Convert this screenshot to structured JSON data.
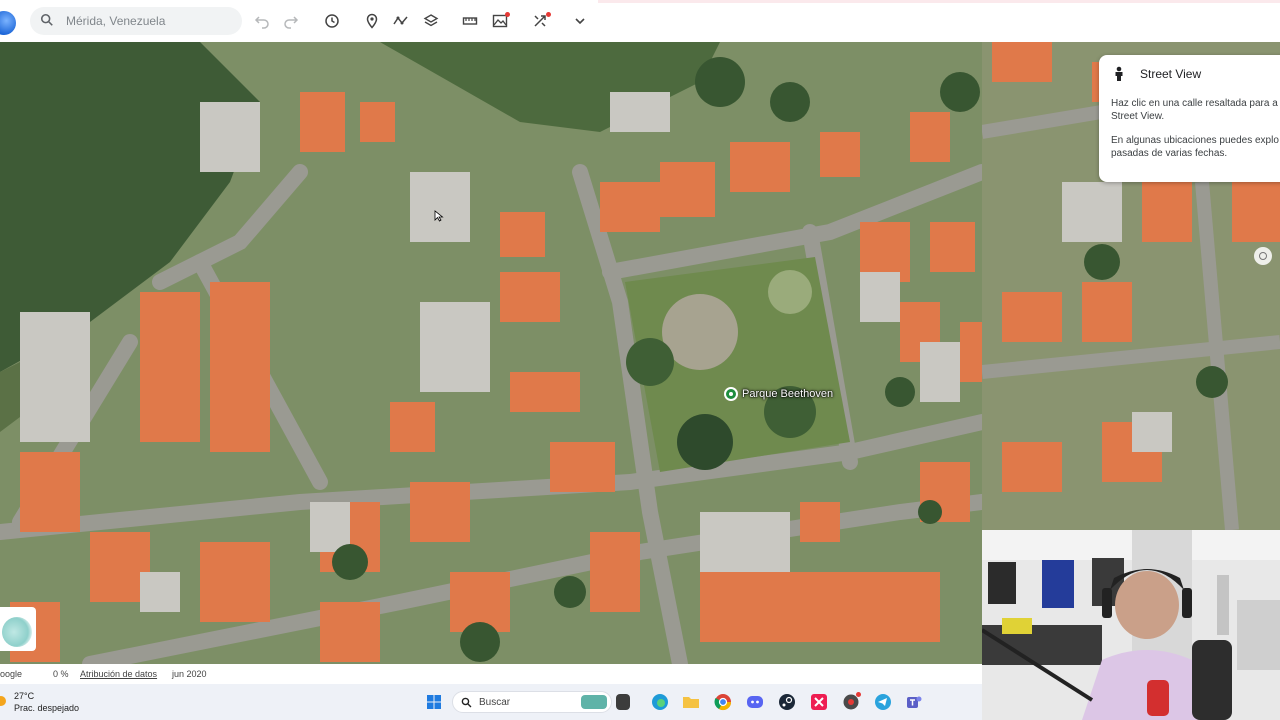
{
  "topbar": {
    "search": {
      "placeholder": "Mérida, Venezuela"
    },
    "icons": [
      "undo-icon",
      "redo-icon",
      "history-icon",
      "place-pin-icon",
      "path-icon",
      "layers-icon",
      "ruler-icon",
      "image-icon",
      "share-icon",
      "chevron-down-icon"
    ]
  },
  "map": {
    "place_label": "Parque Beethoven"
  },
  "street_view_panel": {
    "title": "Street View",
    "line1": "Haz clic en una calle resaltada para a",
    "line2": "Street View.",
    "line3": "En algunas ubicaciones puedes explo",
    "line4": "pasadas de varias fechas."
  },
  "status": {
    "brand": "oogle",
    "loading": "0 %",
    "attribution": "Atribución de datos",
    "imagery_date": "jun 2020"
  },
  "taskbar": {
    "weather_temp": "27°C",
    "weather_desc": "Prac. despejado",
    "search_label": "Buscar"
  },
  "colors": {
    "accent": "#1a73e8",
    "place_pin": "#1e8e3e",
    "roof": "#e0794a"
  }
}
